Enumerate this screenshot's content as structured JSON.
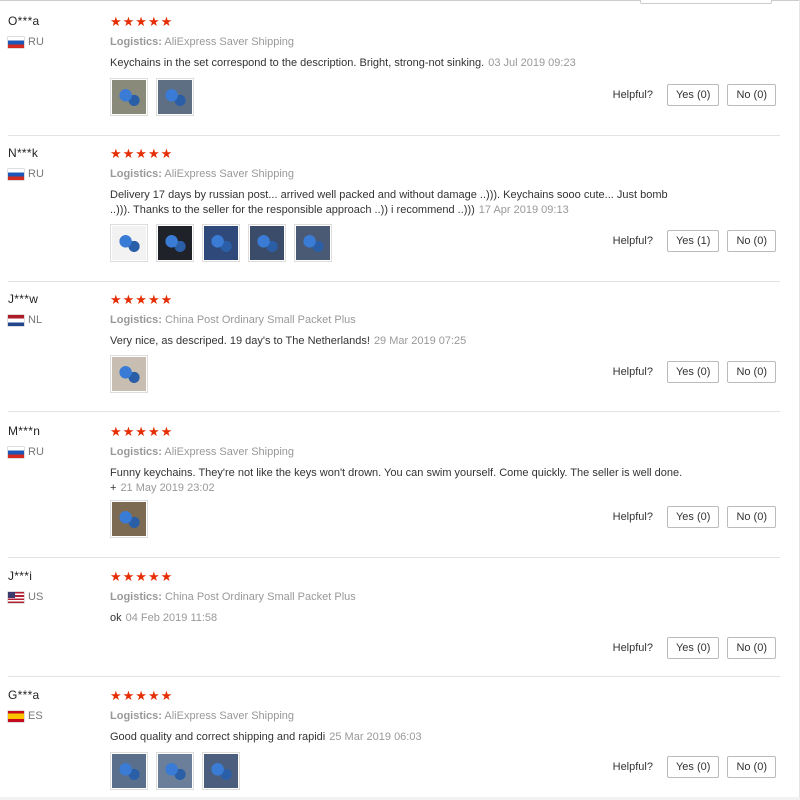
{
  "helpful_label": "Helpful?",
  "reviews": [
    {
      "name": "O***a",
      "country": "RU",
      "stars": "★★★★★",
      "logistics_label": "Logistics:",
      "logistics_value": "AliExpress Saver Shipping",
      "text": "Keychains in the set correspond to the description. Bright, strong-not sinking.",
      "date": "03 Jul 2019 09:23",
      "yes": "Yes (0)",
      "no": "No (0)",
      "photo_count": 2,
      "photo_colors": [
        "#8a8a7a",
        "#5e6f84"
      ]
    },
    {
      "name": "N***k",
      "country": "RU",
      "stars": "★★★★★",
      "logistics_label": "Logistics:",
      "logistics_value": "AliExpress Saver Shipping",
      "text": "Delivery 17 days by russian post... arrived well packed and without damage ..))). Keychains sooo cute... Just bomb ..))). Thanks to the seller for the responsible approach ..)) i recommend ..)))",
      "date": "17 Apr 2019 09:13",
      "yes": "Yes (1)",
      "no": "No (0)",
      "photo_count": 5,
      "photo_colors": [
        "#f2f2f2",
        "#20222a",
        "#2f4a7a",
        "#3a4c6a",
        "#4a5a75"
      ]
    },
    {
      "name": "J***w",
      "country": "NL",
      "stars": "★★★★★",
      "logistics_label": "Logistics:",
      "logistics_value": "China Post Ordinary Small Packet Plus",
      "text": "Very nice, as descriped. 19 day's to The Netherlands!",
      "date": "29 Mar 2019 07:25",
      "yes": "Yes (0)",
      "no": "No (0)",
      "photo_count": 1,
      "photo_colors": [
        "#c7bdb0"
      ]
    },
    {
      "name": "M***n",
      "country": "RU",
      "stars": "★★★★★",
      "logistics_label": "Logistics:",
      "logistics_value": "AliExpress Saver Shipping",
      "text": "Funny keychains. They're not like the keys won't drown. You can swim yourself. Come quickly. The seller is well done. +",
      "date": "21 May 2019 23:02",
      "yes": "Yes (0)",
      "no": "No (0)",
      "photo_count": 1,
      "photo_colors": [
        "#7c6a52"
      ]
    },
    {
      "name": "J***i",
      "country": "US",
      "stars": "★★★★★",
      "logistics_label": "Logistics:",
      "logistics_value": "China Post Ordinary Small Packet Plus",
      "text": "ok",
      "date": "04 Feb 2019 11:58",
      "yes": "Yes (0)",
      "no": "No (0)",
      "photo_count": 0,
      "photo_colors": []
    },
    {
      "name": "G***a",
      "country": "ES",
      "stars": "★★★★★",
      "logistics_label": "Logistics:",
      "logistics_value": "AliExpress Saver Shipping",
      "text": "Good quality and correct shipping and rapidi",
      "date": "25 Mar 2019 06:03",
      "yes": "Yes (0)",
      "no": "No (0)",
      "photo_count": 3,
      "photo_colors": [
        "#5a6f8c",
        "#6b7f9a",
        "#4c5e7e"
      ]
    }
  ]
}
